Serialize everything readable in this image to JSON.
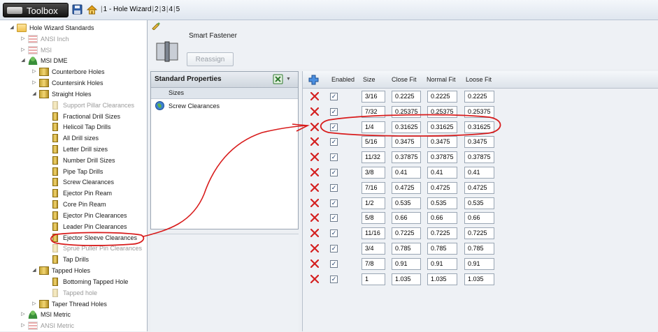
{
  "app": {
    "toolbox_label": "Toolbox",
    "tabs": [
      {
        "label": "1 - Hole Wizard"
      },
      {
        "label": "2"
      },
      {
        "label": "3"
      },
      {
        "label": "4"
      },
      {
        "label": "5"
      }
    ]
  },
  "tree": [
    {
      "label": "Hole Wizard Standards",
      "icon": "folder-icon",
      "level": 0,
      "state": "expanded",
      "grey": false
    },
    {
      "label": "ANSI Inch",
      "icon": "flag-icon",
      "level": 1,
      "state": "collapsed",
      "grey": true
    },
    {
      "label": "MSI",
      "icon": "flag-icon",
      "level": 1,
      "state": "collapsed",
      "grey": true
    },
    {
      "label": "MSI DME",
      "icon": "user-icon",
      "level": 1,
      "state": "expanded",
      "grey": false
    },
    {
      "label": "Counterbore Holes",
      "icon": "screw-group-icon",
      "level": 2,
      "state": "collapsed",
      "grey": false
    },
    {
      "label": "Countersink Holes",
      "icon": "screw-group-icon",
      "level": 2,
      "state": "collapsed",
      "grey": false
    },
    {
      "label": "Straight Holes",
      "icon": "screw-group-icon",
      "level": 2,
      "state": "expanded",
      "grey": false
    },
    {
      "label": "Support Pillar Clearances",
      "icon": "screw-icon",
      "level": 3,
      "state": "none",
      "grey": true
    },
    {
      "label": "Fractional Drill Sizes",
      "icon": "screw-icon",
      "level": 3,
      "state": "none",
      "grey": false
    },
    {
      "label": "Helicoil Tap Drills",
      "icon": "screw-icon",
      "level": 3,
      "state": "none",
      "grey": false
    },
    {
      "label": "All Drill sizes",
      "icon": "screw-icon",
      "level": 3,
      "state": "none",
      "grey": false
    },
    {
      "label": "Letter Drill sizes",
      "icon": "screw-icon",
      "level": 3,
      "state": "none",
      "grey": false
    },
    {
      "label": "Number Drill Sizes",
      "icon": "screw-icon",
      "level": 3,
      "state": "none",
      "grey": false
    },
    {
      "label": "Pipe Tap Drills",
      "icon": "screw-icon",
      "level": 3,
      "state": "none",
      "grey": false
    },
    {
      "label": "Screw Clearances",
      "icon": "screw-icon",
      "level": 3,
      "state": "none",
      "grey": false
    },
    {
      "label": "Ejector Pin Ream",
      "icon": "screw-icon",
      "level": 3,
      "state": "none",
      "grey": false
    },
    {
      "label": "Core Pin Ream",
      "icon": "screw-icon",
      "level": 3,
      "state": "none",
      "grey": false
    },
    {
      "label": "Ejector Pin Clearances",
      "icon": "screw-icon",
      "level": 3,
      "state": "none",
      "grey": false
    },
    {
      "label": "Leader Pin Clearances",
      "icon": "screw-icon",
      "level": 3,
      "state": "none",
      "grey": false
    },
    {
      "label": "Ejector Sleeve Clearances",
      "icon": "screw-icon",
      "level": 3,
      "state": "none",
      "grey": false
    },
    {
      "label": "Sprue Puller Pin Clearances",
      "icon": "screw-icon",
      "level": 3,
      "state": "none",
      "grey": true
    },
    {
      "label": "Tap Drills",
      "icon": "screw-icon",
      "level": 3,
      "state": "none",
      "grey": false
    },
    {
      "label": "Tapped Holes",
      "icon": "screw-group-icon",
      "level": 2,
      "state": "expanded",
      "grey": false
    },
    {
      "label": "Bottoming Tapped Hole",
      "icon": "screw-icon",
      "level": 3,
      "state": "none",
      "grey": false
    },
    {
      "label": "Tapped hole",
      "icon": "screw-icon",
      "level": 3,
      "state": "none",
      "grey": true
    },
    {
      "label": "Taper Thread Holes",
      "icon": "screw-group-icon",
      "level": 2,
      "state": "collapsed",
      "grey": false
    },
    {
      "label": "MSI Metric",
      "icon": "user-icon",
      "level": 1,
      "state": "collapsed",
      "grey": false
    },
    {
      "label": "ANSI Metric",
      "icon": "flag-icon",
      "level": 1,
      "state": "collapsed",
      "grey": true
    }
  ],
  "header": {
    "title": "Smart Fastener",
    "reassign_label": "Reassign"
  },
  "properties": {
    "title": "Standard Properties",
    "sizes_label": "Sizes",
    "item_label": "Screw Clearances"
  },
  "grid": {
    "columns": [
      "Enabled",
      "Size",
      "Close Fit",
      "Normal Fit",
      "Loose Fit"
    ],
    "rows": [
      {
        "enabled": true,
        "size": "3/16",
        "close": "0.2225",
        "normal": "0.2225",
        "loose": "0.2225"
      },
      {
        "enabled": true,
        "size": "7/32",
        "close": "0.25375",
        "normal": "0.25375",
        "loose": "0.25375"
      },
      {
        "enabled": true,
        "size": "1/4",
        "close": "0.31625",
        "normal": "0.31625",
        "loose": "0.31625"
      },
      {
        "enabled": true,
        "size": "5/16",
        "close": "0.3475",
        "normal": "0.3475",
        "loose": "0.3475"
      },
      {
        "enabled": true,
        "size": "11/32",
        "close": "0.37875",
        "normal": "0.37875",
        "loose": "0.37875"
      },
      {
        "enabled": true,
        "size": "3/8",
        "close": "0.41",
        "normal": "0.41",
        "loose": "0.41"
      },
      {
        "enabled": true,
        "size": "7/16",
        "close": "0.4725",
        "normal": "0.4725",
        "loose": "0.4725"
      },
      {
        "enabled": true,
        "size": "1/2",
        "close": "0.535",
        "normal": "0.535",
        "loose": "0.535"
      },
      {
        "enabled": true,
        "size": "5/8",
        "close": "0.66",
        "normal": "0.66",
        "loose": "0.66"
      },
      {
        "enabled": true,
        "size": "11/16",
        "close": "0.7225",
        "normal": "0.7225",
        "loose": "0.7225"
      },
      {
        "enabled": true,
        "size": "3/4",
        "close": "0.785",
        "normal": "0.785",
        "loose": "0.785"
      },
      {
        "enabled": true,
        "size": "7/8",
        "close": "0.91",
        "normal": "0.91",
        "loose": "0.91"
      },
      {
        "enabled": true,
        "size": "1",
        "close": "1.035",
        "normal": "1.035",
        "loose": "1.035"
      }
    ]
  },
  "colors": {
    "annotation": "#d81b1b",
    "delete": "#d42020",
    "accent": "#2e6bb8"
  }
}
